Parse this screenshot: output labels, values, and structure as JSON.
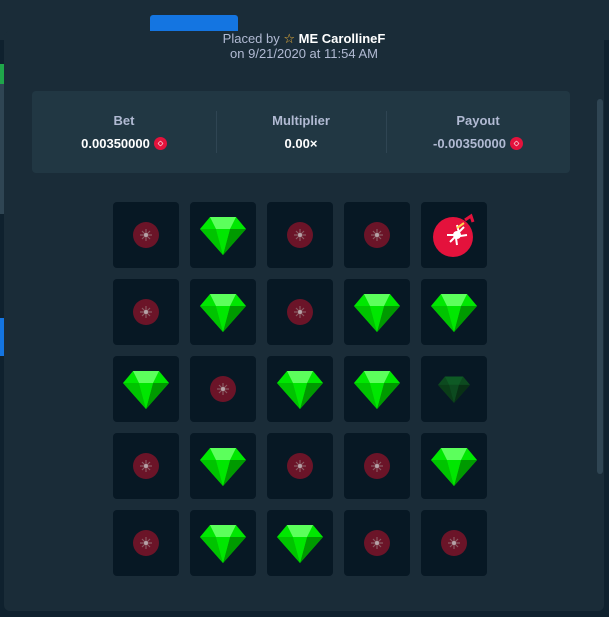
{
  "modal": {
    "placed_by_prefix": "Placed by",
    "user_name": "ME CarollineF",
    "placed_on": "on 9/21/2020 at 11:54 AM"
  },
  "stats": {
    "bet_label": "Bet",
    "bet_value": "0.00350000",
    "multiplier_label": "Multiplier",
    "multiplier_value": "0.00×",
    "payout_label": "Payout",
    "payout_value": "-0.00350000"
  },
  "colors": {
    "gem": "#00e701",
    "bomb": "#e4123c",
    "background": "#1a2c38"
  },
  "board": [
    [
      "bomb-dim",
      "gem",
      "bomb-dim",
      "bomb-dim",
      "bomb-hit"
    ],
    [
      "bomb-dim",
      "gem",
      "bomb-dim",
      "gem",
      "gem"
    ],
    [
      "gem",
      "bomb-dim",
      "gem",
      "gem",
      "gem-dim"
    ],
    [
      "bomb-dim",
      "gem",
      "bomb-dim",
      "bomb-dim",
      "gem"
    ],
    [
      "bomb-dim",
      "gem",
      "gem",
      "bomb-dim",
      "bomb-dim"
    ]
  ]
}
